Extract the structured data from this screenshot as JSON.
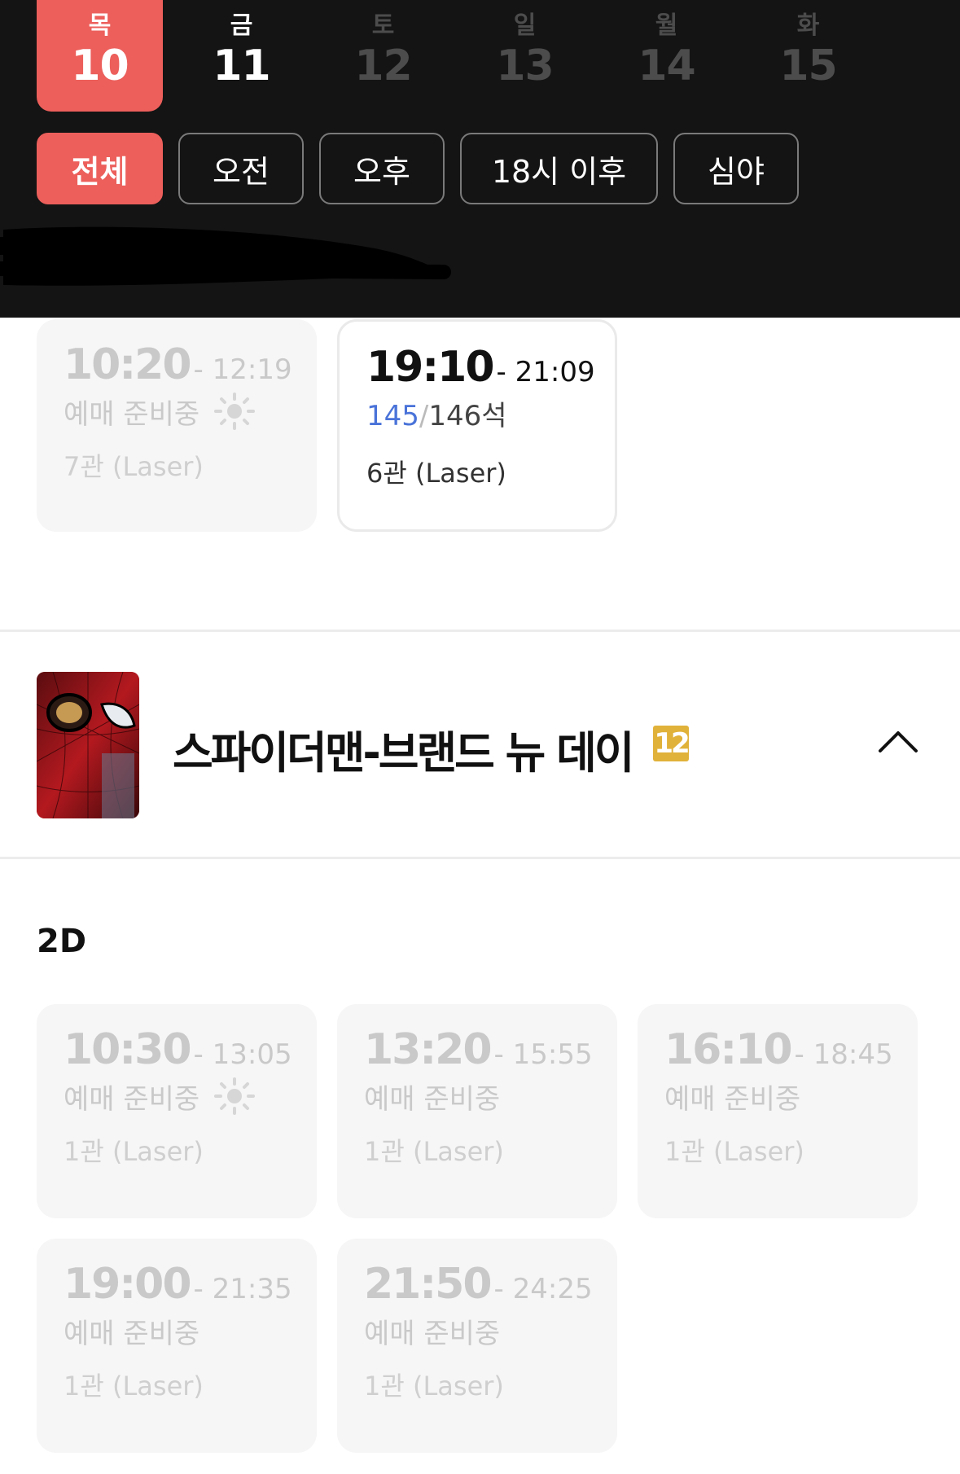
{
  "dates": [
    {
      "dow": "목",
      "day": "10",
      "state": "active"
    },
    {
      "dow": "금",
      "day": "11",
      "state": "normal"
    },
    {
      "dow": "토",
      "day": "12",
      "state": "muted"
    },
    {
      "dow": "일",
      "day": "13",
      "state": "muted"
    },
    {
      "dow": "월",
      "day": "14",
      "state": "muted"
    },
    {
      "dow": "화",
      "day": "15",
      "state": "muted"
    }
  ],
  "filters": [
    "전체",
    "오전",
    "오후",
    "18시 이후",
    "심야"
  ],
  "prev_showtimes": [
    {
      "start": "10:20",
      "end": "- 12:19",
      "status": "예매 준비중",
      "morning_icon": true,
      "hall": "7관 (Laser)",
      "enabled": false
    },
    {
      "start": "19:10",
      "end": "- 21:09",
      "seats_available": "145",
      "seats_separator": "/",
      "seats_total": "146석",
      "hall": "6관 (Laser)",
      "enabled": true
    }
  ],
  "movie": {
    "title": "스파이더맨-브랜드 뉴 데이",
    "rating": "12",
    "poster_icon": "spiderman-poster",
    "collapse_icon": "chevron-up-icon"
  },
  "format": "2D",
  "showtimes": [
    {
      "start": "10:30",
      "end": "- 13:05",
      "status": "예매 준비중",
      "morning_icon": true,
      "hall": "1관 (Laser)",
      "enabled": false
    },
    {
      "start": "13:20",
      "end": "- 15:55",
      "status": "예매 준비중",
      "morning_icon": false,
      "hall": "1관 (Laser)",
      "enabled": false
    },
    {
      "start": "16:10",
      "end": "- 18:45",
      "status": "예매 준비중",
      "morning_icon": false,
      "hall": "1관 (Laser)",
      "enabled": false
    },
    {
      "start": "19:00",
      "end": "- 21:35",
      "status": "예매 준비중",
      "morning_icon": false,
      "hall": "1관 (Laser)",
      "enabled": false
    },
    {
      "start": "21:50",
      "end": "- 24:25",
      "status": "예매 준비중",
      "morning_icon": false,
      "hall": "1관 (Laser)",
      "enabled": false
    }
  ],
  "colors": {
    "accent": "#ec5f5b",
    "header_bg": "#141414",
    "seat_available": "#4a73d9",
    "rating_12": "#e1b23a"
  }
}
